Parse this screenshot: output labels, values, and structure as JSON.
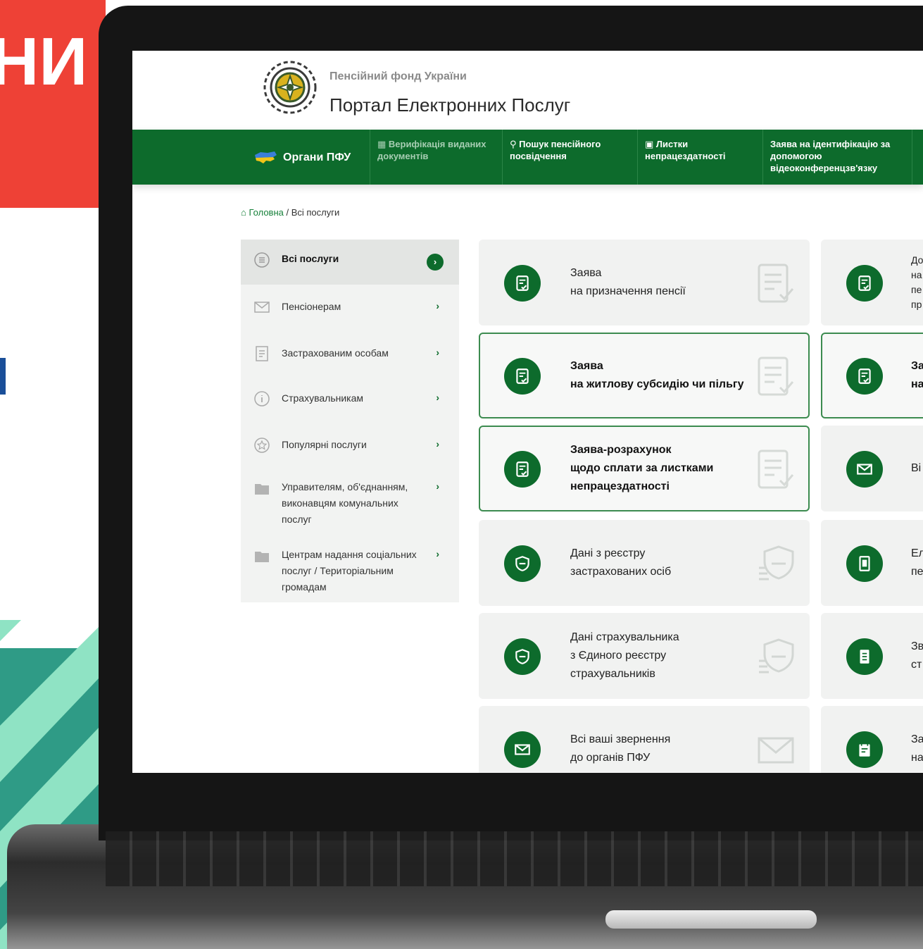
{
  "background": {
    "red_banner_text": "НИ"
  },
  "header": {
    "org_name": "Пенсійний фонд України",
    "portal_name": "Портал Електронних Послуг"
  },
  "nav": {
    "items": [
      {
        "label": "Органи ПФУ"
      },
      {
        "label": "Верифікація виданих документів"
      },
      {
        "label": "Пошук пенсійного посвідчення"
      },
      {
        "label": "Листки непрацездатності"
      },
      {
        "label": "Заява на ідентифікацію за допомогою відеоконференцзв'язку"
      }
    ]
  },
  "breadcrumb": {
    "home": "Головна",
    "separator": " / ",
    "current": "Всі послуги"
  },
  "sidebar": {
    "items": [
      {
        "label": "Всі послуги",
        "icon": "list-icon"
      },
      {
        "label": "Пенсіонерам",
        "icon": "envelope-icon"
      },
      {
        "label": "Застрахованим особам",
        "icon": "document-icon"
      },
      {
        "label": "Страхувальникам",
        "icon": "info-icon"
      },
      {
        "label": "Популярні послуги",
        "icon": "star-icon"
      },
      {
        "label": "Управителям, об'єднанням, виконавцям комунальних послуг",
        "icon": "folder-icon"
      },
      {
        "label": "Центрам надання соціальних послуг / Територіальним громадам",
        "icon": "folder-icon"
      }
    ]
  },
  "services": {
    "col1": [
      {
        "lines": [
          "Заява",
          "на призначення пенсії"
        ],
        "icon": "document-check-icon"
      },
      {
        "lines": [
          "Заява",
          "на житлову субсидію чи пільгу"
        ],
        "icon": "document-check-icon"
      },
      {
        "lines": [
          "Заява-розрахунок",
          "щодо сплати за листками",
          "непрацездатності"
        ],
        "icon": "document-check-icon"
      },
      {
        "lines": [
          "Дані з реєстру",
          "застрахованих осіб"
        ],
        "icon": "shield-icon"
      },
      {
        "lines": [
          "Дані страхувальника",
          "з Єдиного реєстру",
          "страхувальників"
        ],
        "icon": "shield-icon"
      },
      {
        "lines": [
          "Всі ваші звернення",
          "до органів ПФУ"
        ],
        "icon": "envelope-icon"
      }
    ],
    "col2": [
      {
        "lines": [
          "До",
          "на",
          "пе",
          "пр"
        ],
        "icon": "document-check-icon"
      },
      {
        "lines": [
          "За",
          "на"
        ],
        "icon": "document-check-icon"
      },
      {
        "lines": [
          "Ві"
        ],
        "icon": "envelope-icon"
      },
      {
        "lines": [
          "Ел",
          "пе"
        ],
        "icon": "id-card-icon"
      },
      {
        "lines": [
          "Зв",
          "ст"
        ],
        "icon": "report-icon"
      },
      {
        "lines": [
          "За",
          "на"
        ],
        "icon": "calendar-icon"
      }
    ]
  },
  "colors": {
    "brand_green": "#0d6b2c",
    "accent_red": "#ee4136",
    "accent_blue": "#1a4f99",
    "teal": "#2f9b86",
    "mint": "#8fe3c4"
  }
}
